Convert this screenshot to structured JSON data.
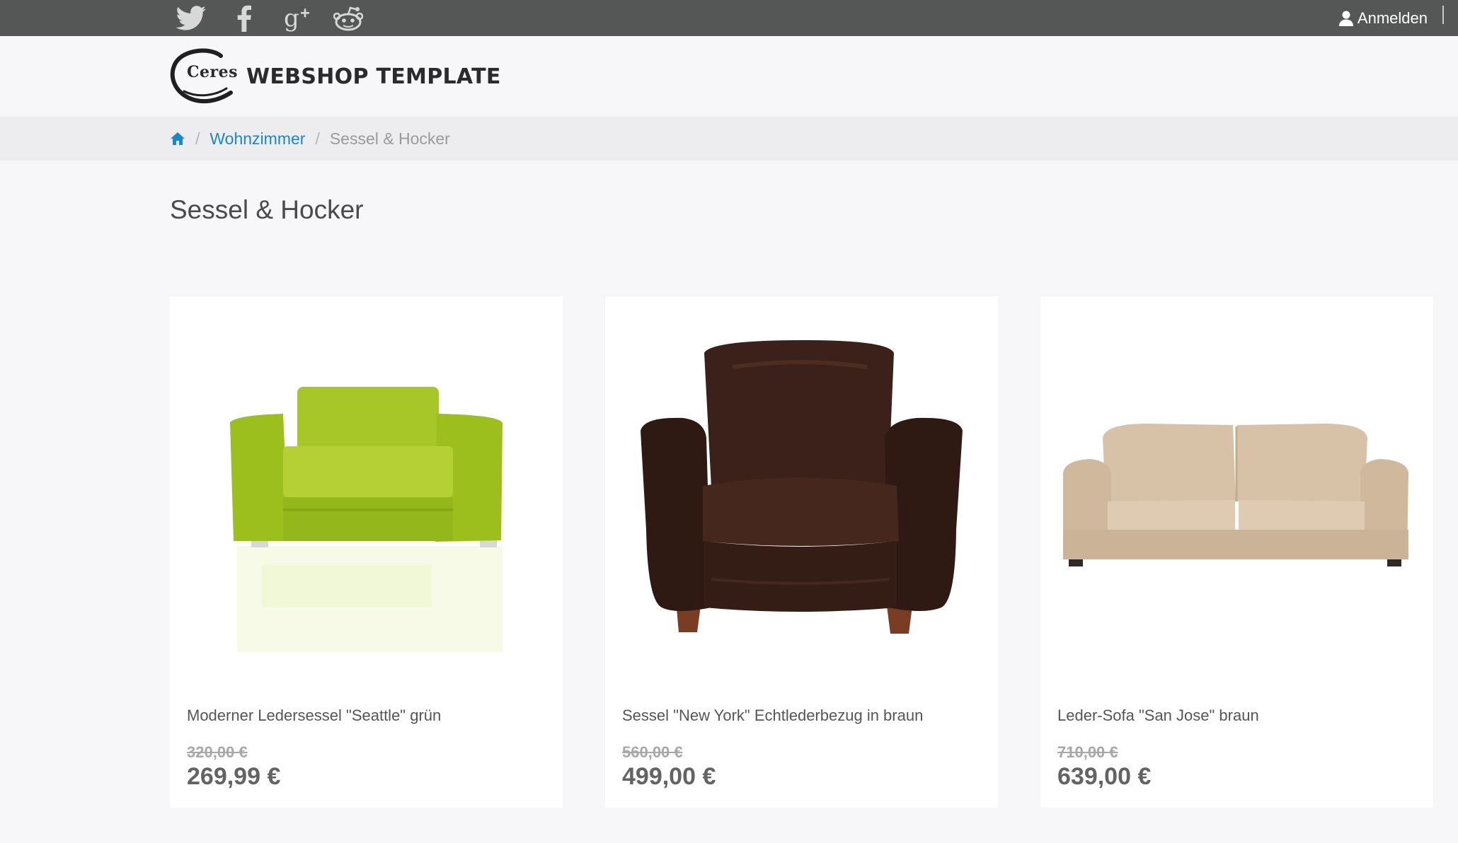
{
  "topbar": {
    "social_icons": [
      "twitter-icon",
      "facebook-icon",
      "google-plus-icon",
      "reddit-icon"
    ],
    "login_label": "Anmelden",
    "login_icon": "user-icon"
  },
  "header": {
    "logo_text": "Ceres",
    "brand_name": "WEBSHOP TEMPLATE"
  },
  "breadcrumb": {
    "home_icon": "home-icon",
    "items": [
      {
        "label": "Wohnzimmer",
        "link": true
      },
      {
        "label": "Sessel & Hocker",
        "link": false
      }
    ]
  },
  "page": {
    "title": "Sessel & Hocker"
  },
  "products": [
    {
      "name": "Moderner Ledersessel \"Seattle\" grün",
      "old_price": "320,00 €",
      "price": "269,99 €",
      "image": "green-armchair-image"
    },
    {
      "name": "Sessel \"New York\" Echtlederbezug in braun",
      "old_price": "560,00 €",
      "price": "499,00 €",
      "image": "brown-leather-armchair-image"
    },
    {
      "name": "Leder-Sofa \"San Jose\" braun",
      "old_price": "710,00 €",
      "price": "639,00 €",
      "image": "beige-leather-sofa-image"
    }
  ],
  "colors": {
    "topbar": "#555656",
    "link": "#1a87c9",
    "background": "#f7f7f9",
    "breadcrumb_bar": "#ededef"
  }
}
